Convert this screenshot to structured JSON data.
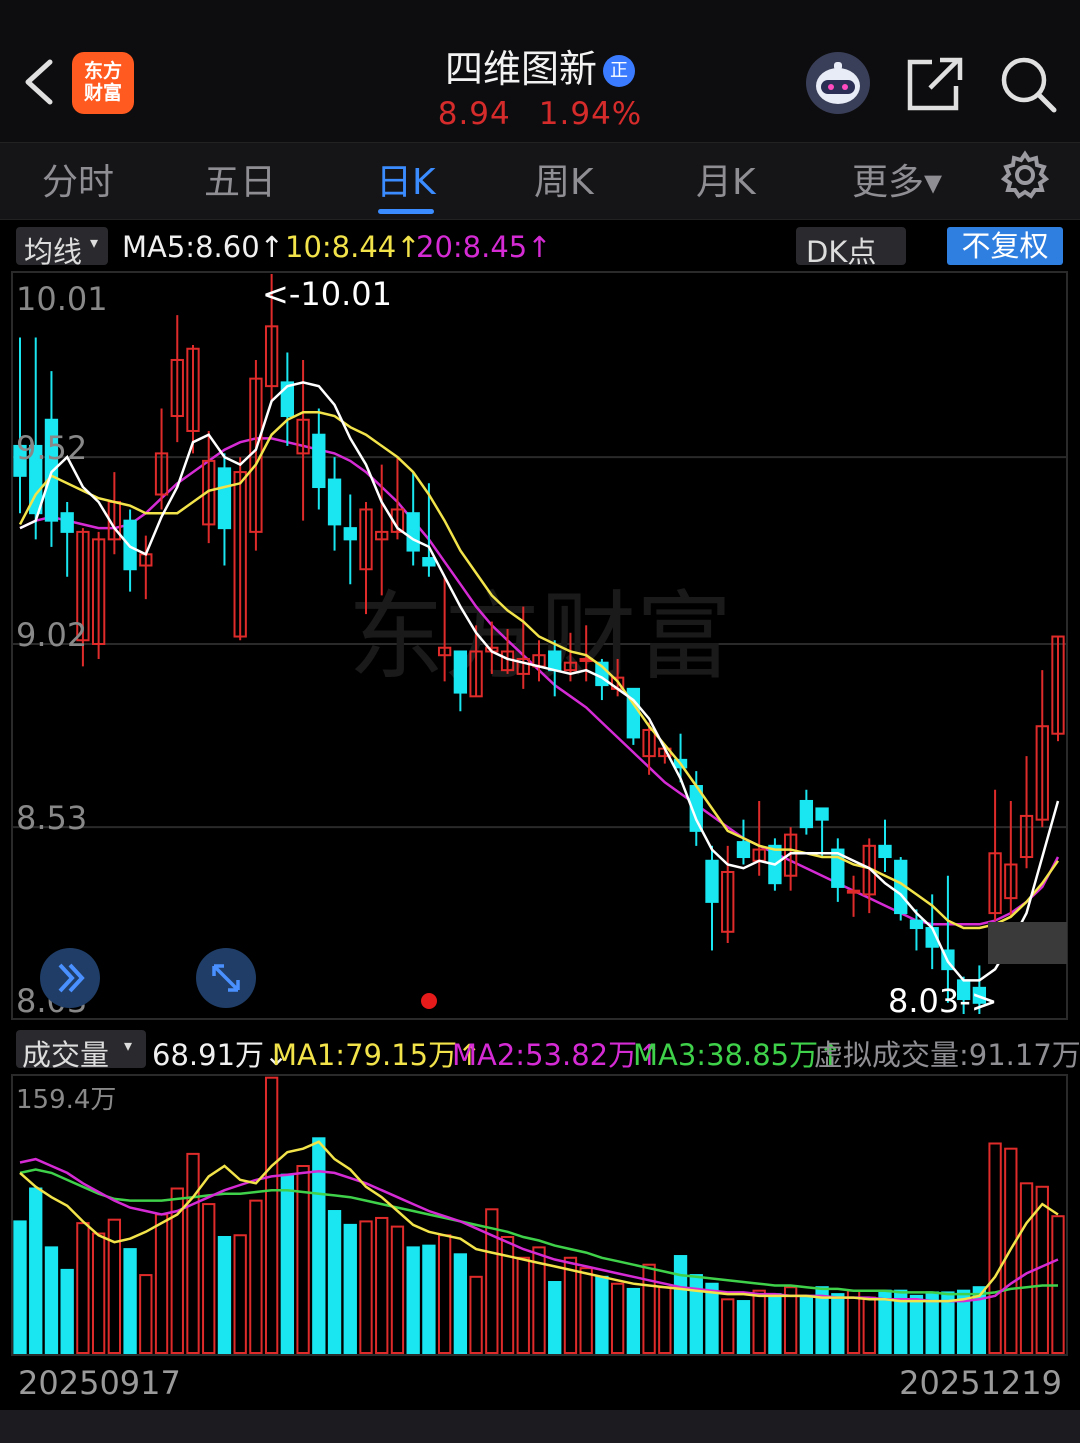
{
  "header": {
    "logo_text_1": "东方",
    "logo_text_2": "财富",
    "title": "四维图新",
    "badge": "正",
    "price": "8.94",
    "change_pct": "1.94%"
  },
  "tabs": [
    "分时",
    "五日",
    "日K",
    "周K",
    "月K",
    "更多▾"
  ],
  "ma_bar": {
    "select": "均线",
    "ma5": "MA5:8.60↑",
    "ma10": "10:8.44↑",
    "ma20": "20:8.45↑",
    "dk": "DK点",
    "fq": "不复权"
  },
  "price_axis": [
    "10.01",
    "9.52",
    "9.02",
    "8.53",
    "8.03"
  ],
  "annotations": {
    "high": "<-10.01",
    "low": "8.03->"
  },
  "watermark": "东方财富",
  "volume_bar": {
    "select": "成交量",
    "vol": "68.91万↓",
    "ma1": "MA1:79.15万↑",
    "ma2": "MA2:53.82万↑",
    "ma3": "MA3:38.85万↑",
    "virtual": "虚拟成交量:91.17万"
  },
  "volume_axis_max": "159.4万",
  "dates": {
    "start": "20250917",
    "end": "20251219"
  },
  "colors": {
    "up": "#e02b2b",
    "down": "#19e6f0",
    "ma5": "#ffffff",
    "ma10": "#f2e34a",
    "ma20": "#d42bd4",
    "ma3": "#3fd14a",
    "accent": "#3b8cff"
  },
  "chart_data": {
    "type": "candlestick",
    "ylim": [
      8.03,
      10.01
    ],
    "candles": [
      [
        9.55,
        9.47,
        9.84,
        9.37
      ],
      [
        9.55,
        9.37,
        9.84,
        9.3
      ],
      [
        9.62,
        9.35,
        9.75,
        9.28
      ],
      [
        9.37,
        9.32,
        9.4,
        9.2
      ],
      [
        9.03,
        9.32,
        9.33,
        8.96
      ],
      [
        9.02,
        9.3,
        9.32,
        8.98
      ],
      [
        9.3,
        9.4,
        9.48,
        9.26
      ],
      [
        9.35,
        9.22,
        9.38,
        9.16
      ],
      [
        9.23,
        9.26,
        9.31,
        9.14
      ],
      [
        9.42,
        9.53,
        9.65,
        9.38
      ],
      [
        9.63,
        9.78,
        9.9,
        9.56
      ],
      [
        9.59,
        9.81,
        9.82,
        9.53
      ],
      [
        9.34,
        9.51,
        9.59,
        9.29
      ],
      [
        9.49,
        9.33,
        9.53,
        9.23
      ],
      [
        9.04,
        9.48,
        9.52,
        9.03
      ],
      [
        9.32,
        9.73,
        9.78,
        9.27
      ],
      [
        9.71,
        9.87,
        10.01,
        9.67
      ],
      [
        9.72,
        9.63,
        9.8,
        9.55
      ],
      [
        9.53,
        9.62,
        9.78,
        9.35
      ],
      [
        9.58,
        9.44,
        9.65,
        9.38
      ],
      [
        9.46,
        9.34,
        9.52,
        9.27
      ],
      [
        9.33,
        9.3,
        9.42,
        9.18
      ],
      [
        9.22,
        9.38,
        9.4,
        9.1
      ],
      [
        9.3,
        9.32,
        9.5,
        9.15
      ],
      [
        9.32,
        9.38,
        9.52,
        9.3
      ],
      [
        9.37,
        9.27,
        9.48,
        9.23
      ],
      [
        9.25,
        9.23,
        9.45,
        9.2
      ],
      [
        8.99,
        9.01,
        9.2,
        8.92
      ],
      [
        9.0,
        8.89,
        9.0,
        8.84
      ],
      [
        8.88,
        9.0,
        9.07,
        8.88
      ],
      [
        9.0,
        9.01,
        9.08,
        8.94
      ],
      [
        8.95,
        9.0,
        9.06,
        8.94
      ],
      [
        8.94,
        8.98,
        9.12,
        8.9
      ],
      [
        8.96,
        8.99,
        9.03,
        8.92
      ],
      [
        9.0,
        8.95,
        9.03,
        8.88
      ],
      [
        8.95,
        8.97,
        9.05,
        8.92
      ],
      [
        8.98,
        8.98,
        9.07,
        8.92
      ],
      [
        8.97,
        8.91,
        8.98,
        8.87
      ],
      [
        8.9,
        8.93,
        8.98,
        8.88
      ],
      [
        8.9,
        8.77,
        8.9,
        8.75
      ],
      [
        8.72,
        8.79,
        8.81,
        8.67
      ],
      [
        8.72,
        8.74,
        8.75,
        8.7
      ],
      [
        8.71,
        8.69,
        8.78,
        8.65
      ],
      [
        8.64,
        8.52,
        8.68,
        8.48
      ],
      [
        8.44,
        8.33,
        8.48,
        8.2
      ],
      [
        8.25,
        8.41,
        8.48,
        8.22
      ],
      [
        8.49,
        8.45,
        8.55,
        8.43
      ],
      [
        8.44,
        8.47,
        8.6,
        8.4
      ],
      [
        8.48,
        8.38,
        8.5,
        8.36
      ],
      [
        8.4,
        8.51,
        8.53,
        8.36
      ],
      [
        8.6,
        8.53,
        8.63,
        8.51
      ],
      [
        8.58,
        8.55,
        8.56,
        8.45
      ],
      [
        8.47,
        8.37,
        8.5,
        8.33
      ],
      [
        8.36,
        8.36,
        8.4,
        8.29
      ],
      [
        8.35,
        8.48,
        8.5,
        8.3
      ],
      [
        8.48,
        8.45,
        8.55,
        8.41
      ],
      [
        8.44,
        8.3,
        8.45,
        8.28
      ],
      [
        8.28,
        8.26,
        8.31,
        8.2
      ],
      [
        8.26,
        8.21,
        8.35,
        8.15
      ],
      [
        8.2,
        8.15,
        8.4,
        8.06
      ],
      [
        8.12,
        8.07,
        8.13,
        8.03
      ],
      [
        8.1,
        8.06,
        8.16,
        8.03
      ],
      [
        8.3,
        8.46,
        8.63,
        8.28
      ],
      [
        8.34,
        8.43,
        8.6,
        8.29
      ],
      [
        8.45,
        8.56,
        8.72,
        8.42
      ],
      [
        8.55,
        8.8,
        8.95,
        8.53
      ],
      [
        8.78,
        9.04,
        9.04,
        8.76
      ]
    ],
    "ma5": [
      9.33,
      9.35,
      9.48,
      9.52,
      9.44,
      9.4,
      9.33,
      9.28,
      9.26,
      9.36,
      9.44,
      9.56,
      9.58,
      9.52,
      9.5,
      9.54,
      9.67,
      9.71,
      9.72,
      9.71,
      9.66,
      9.57,
      9.5,
      9.4,
      9.33,
      9.3,
      9.28,
      9.2,
      9.12,
      9.05,
      9.0,
      8.98,
      8.97,
      8.96,
      8.95,
      8.94,
      8.95,
      8.93,
      8.9,
      8.87,
      8.82,
      8.74,
      8.66,
      8.55,
      8.47,
      8.43,
      8.42,
      8.44,
      8.43,
      8.46,
      8.46,
      8.46,
      8.46,
      8.44,
      8.42,
      8.38,
      8.35,
      8.3,
      8.26,
      8.17,
      8.12,
      8.12,
      8.15,
      8.22,
      8.3,
      8.45,
      8.6
    ],
    "ma10": [
      9.34,
      9.42,
      9.47,
      9.45,
      9.43,
      9.41,
      9.4,
      9.39,
      9.37,
      9.37,
      9.37,
      9.4,
      9.43,
      9.44,
      9.45,
      9.5,
      9.58,
      9.62,
      9.64,
      9.64,
      9.63,
      9.6,
      9.58,
      9.55,
      9.52,
      9.48,
      9.42,
      9.35,
      9.27,
      9.21,
      9.15,
      9.11,
      9.08,
      9.04,
      9.02,
      9.0,
      8.99,
      8.96,
      8.92,
      8.86,
      8.8,
      8.75,
      8.7,
      8.64,
      8.58,
      8.52,
      8.5,
      8.48,
      8.47,
      8.47,
      8.46,
      8.45,
      8.45,
      8.43,
      8.42,
      8.4,
      8.38,
      8.35,
      8.32,
      8.28,
      8.26,
      8.26,
      8.27,
      8.29,
      8.33,
      8.38,
      8.44
    ],
    "ma20": [
      9.33,
      9.35,
      9.36,
      9.35,
      9.34,
      9.33,
      9.33,
      9.34,
      9.37,
      9.41,
      9.45,
      9.48,
      9.51,
      9.54,
      9.56,
      9.57,
      9.57,
      9.56,
      9.55,
      9.54,
      9.53,
      9.51,
      9.48,
      9.44,
      9.4,
      9.35,
      9.3,
      9.24,
      9.18,
      9.12,
      9.07,
      9.03,
      8.99,
      8.95,
      8.91,
      8.88,
      8.85,
      8.81,
      8.77,
      8.73,
      8.69,
      8.65,
      8.62,
      8.59,
      8.56,
      8.53,
      8.5,
      8.48,
      8.46,
      8.44,
      8.42,
      8.4,
      8.38,
      8.36,
      8.34,
      8.32,
      8.3,
      8.28,
      8.27,
      8.27,
      8.27,
      8.27,
      8.28,
      8.3,
      8.33,
      8.37,
      8.45
    ],
    "volume_ylim": [
      0,
      159.4
    ],
    "volume": [
      76,
      95,
      61,
      48,
      75,
      69,
      77,
      60,
      45,
      80,
      95,
      115,
      86,
      67,
      68,
      88,
      159,
      103,
      108,
      124,
      82,
      74,
      76,
      78,
      73,
      61,
      62,
      68,
      57,
      44,
      83,
      67,
      55,
      61,
      41,
      55,
      49,
      44,
      40,
      37,
      51,
      38,
      56,
      45,
      40,
      31,
      30,
      36,
      34,
      38,
      33,
      38,
      34,
      36,
      32,
      36,
      36,
      33,
      35,
      35,
      36,
      38,
      121,
      118,
      98,
      96,
      79
    ],
    "vol_ma1": [
      104,
      96,
      90,
      85,
      76,
      68,
      64,
      66,
      70,
      75,
      80,
      90,
      102,
      108,
      100,
      98,
      108,
      116,
      118,
      122,
      112,
      106,
      96,
      90,
      82,
      74,
      70,
      68,
      66,
      60,
      58,
      56,
      54,
      52,
      50,
      48,
      46,
      44,
      42,
      40,
      39,
      38,
      37,
      36,
      35,
      34,
      34,
      33,
      33,
      33,
      33,
      32,
      32,
      32,
      31,
      31,
      30,
      30,
      30,
      30,
      31,
      33,
      44,
      60,
      75,
      86,
      80
    ],
    "vol_ma2": [
      110,
      112,
      108,
      104,
      98,
      93,
      88,
      84,
      82,
      80,
      82,
      86,
      90,
      94,
      97,
      100,
      102,
      103,
      104,
      105,
      104,
      101,
      98,
      94,
      90,
      86,
      82,
      79,
      76,
      72,
      68,
      64,
      60,
      57,
      54,
      52,
      50,
      48,
      46,
      44,
      42,
      40,
      38,
      37,
      36,
      35,
      35,
      34,
      34,
      33,
      33,
      33,
      32,
      32,
      32,
      31,
      31,
      31,
      30,
      30,
      30,
      31,
      33,
      40,
      46,
      50,
      54
    ],
    "vol_ma3": [
      104,
      106,
      104,
      100,
      96,
      92,
      89,
      88,
      88,
      88,
      89,
      90,
      91,
      92,
      92,
      93,
      94,
      94,
      93,
      92,
      91,
      90,
      88,
      86,
      84,
      82,
      80,
      78,
      76,
      74,
      72,
      70,
      67,
      65,
      62,
      60,
      58,
      55,
      53,
      51,
      49,
      47,
      45,
      44,
      43,
      42,
      41,
      40,
      39,
      39,
      38,
      37,
      37,
      36,
      36,
      36,
      35,
      35,
      35,
      34,
      34,
      34,
      35,
      37,
      38,
      39,
      39
    ]
  }
}
